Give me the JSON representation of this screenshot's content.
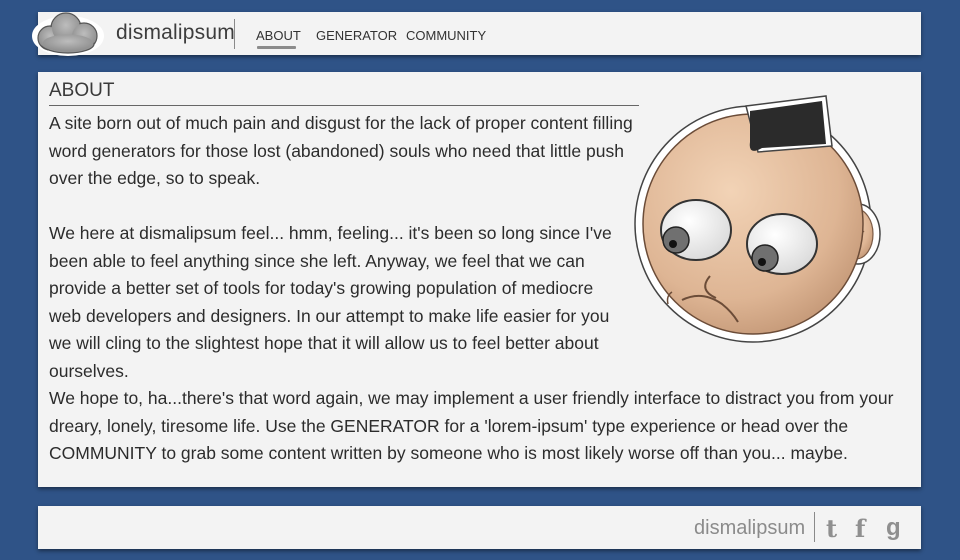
{
  "header": {
    "site_name": "dismalipsum",
    "nav": [
      {
        "label": "ABOUT"
      },
      {
        "label": "GENERATOR"
      },
      {
        "label": "COMMUNITY"
      }
    ],
    "logo_icon": "cloud-icon"
  },
  "main": {
    "heading": "ABOUT",
    "paragraphs": [
      "A site born out of much pain and disgust for the lack of proper content filling word generators for those lost (abandoned) souls who need that little push over the edge, so to speak.",
      "We here at dismalipsum feel... hmm, feeling... it's been so long since I've been able to feel anything since she left. Anyway, we feel that we can provide a better set of tools for today's growing population of mediocre web developers and designers. In our attempt to make life easier for you we will cling to the slightest hope that it will allow us to feel better about ourselves.",
      "We hope to, ha...there's that word again, we may implement a user friendly interface to distract you from your dreary, lonely, tiresome life.  Use the GENERATOR for a 'lorem-ipsum' type experience or head over the COMMUNITY to grab some content written by someone who is most likely worse off than you... maybe."
    ],
    "mascot_icon": "mascot-face-icon"
  },
  "footer": {
    "site_name": "dismalipsum",
    "social": [
      {
        "icon": "tumblr-icon",
        "glyph": "t"
      },
      {
        "icon": "facebook-icon",
        "glyph": "f"
      },
      {
        "icon": "google-icon",
        "glyph": "g"
      }
    ]
  },
  "colors": {
    "background": "#2f5387",
    "panel": "#f3f3f3",
    "text": "#2c2c2c",
    "muted": "#8b8b8b"
  }
}
